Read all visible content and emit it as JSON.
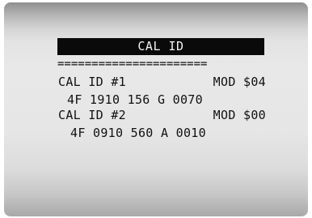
{
  "screen": {
    "title": "CAL ID",
    "separator": "======================",
    "entries": [
      {
        "label": "CAL ID #1",
        "module": "MOD $04",
        "value": "4F 1910 156 G 0070"
      },
      {
        "label": "CAL ID #2",
        "module": "MOD $00",
        "value": "4F 0910 560 A 0010"
      }
    ]
  },
  "colors": {
    "title_bar_bg": "#0a0a0a",
    "title_text": "#f2f2f2",
    "text": "#111111",
    "screen_bg": "#e6e6e6"
  }
}
